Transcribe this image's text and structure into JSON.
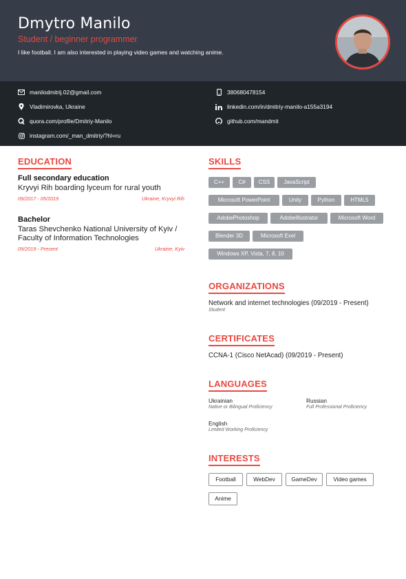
{
  "header": {
    "name": "Dmytro Manilo",
    "subtitle": "Student / beginner programmer",
    "summary": "I like football. I am also interested in playing video games and watching anime."
  },
  "contacts": {
    "email": "manilodmitrij.02@gmail.com",
    "location": "Vladimirovka, Ukraine",
    "quora": "quora.com/profile/Dmitriy-Manilo",
    "instagram": "instagram.com/_man_dmitriy/?hl=ru",
    "phone": "380680478154",
    "linkedin": "linkedin.com/in/dmitriy-manilo-a155a3194",
    "github": "github.com/mandmit"
  },
  "education": {
    "title": "EDUCATION",
    "items": [
      {
        "degree": "Full secondary education",
        "school": "Kryvyi Rih boarding lyceum for rural youth",
        "dates": "09/2017 - 05/2019",
        "place": "Ukraine, Kryvyi Rih"
      },
      {
        "degree": "Bachelor",
        "school": "Taras Shevchenko National University of Kyiv / Faculty of Information Technologies",
        "dates": "09/2019 - Present",
        "place": "Ukraine, Kyiv"
      }
    ]
  },
  "skills": {
    "title": "SKILLS",
    "items": [
      "C++",
      "C#",
      "CSS",
      "JavaScript",
      "Microsoft PowerPoint",
      "Unity",
      "Python",
      "HTML5",
      "AdobePhotoshop",
      "AdobeIllustrator",
      "Microsoft Word",
      "Blender 3D",
      "Microsoft Exel",
      "Windows XP, Vista, 7, 8, 10"
    ]
  },
  "organizations": {
    "title": "ORGANIZATIONS",
    "name": "Network and internet technologies (09/2019 - Present)",
    "role": "Student"
  },
  "certificates": {
    "title": "CERTIFICATES",
    "item": "CCNA-1 (Cisco NetAcad) (09/2019 - Present)"
  },
  "languages": {
    "title": "LANGUAGES",
    "items": [
      {
        "name": "Ukrainian",
        "level": "Native or Bilingual Proficiency"
      },
      {
        "name": "Russian",
        "level": "Full Professional Proficiency"
      },
      {
        "name": "English",
        "level": "Limited Working Proficiency"
      }
    ]
  },
  "interests": {
    "title": "INTERESTS",
    "items": [
      "Football",
      "WebDev",
      "GameDev",
      "Video games",
      "Anime"
    ]
  },
  "colors": {
    "accent": "#e8473f",
    "header_bg": "#373d48",
    "contact_bg": "#1f2529",
    "skill_tag_bg": "#9a9ea3"
  }
}
